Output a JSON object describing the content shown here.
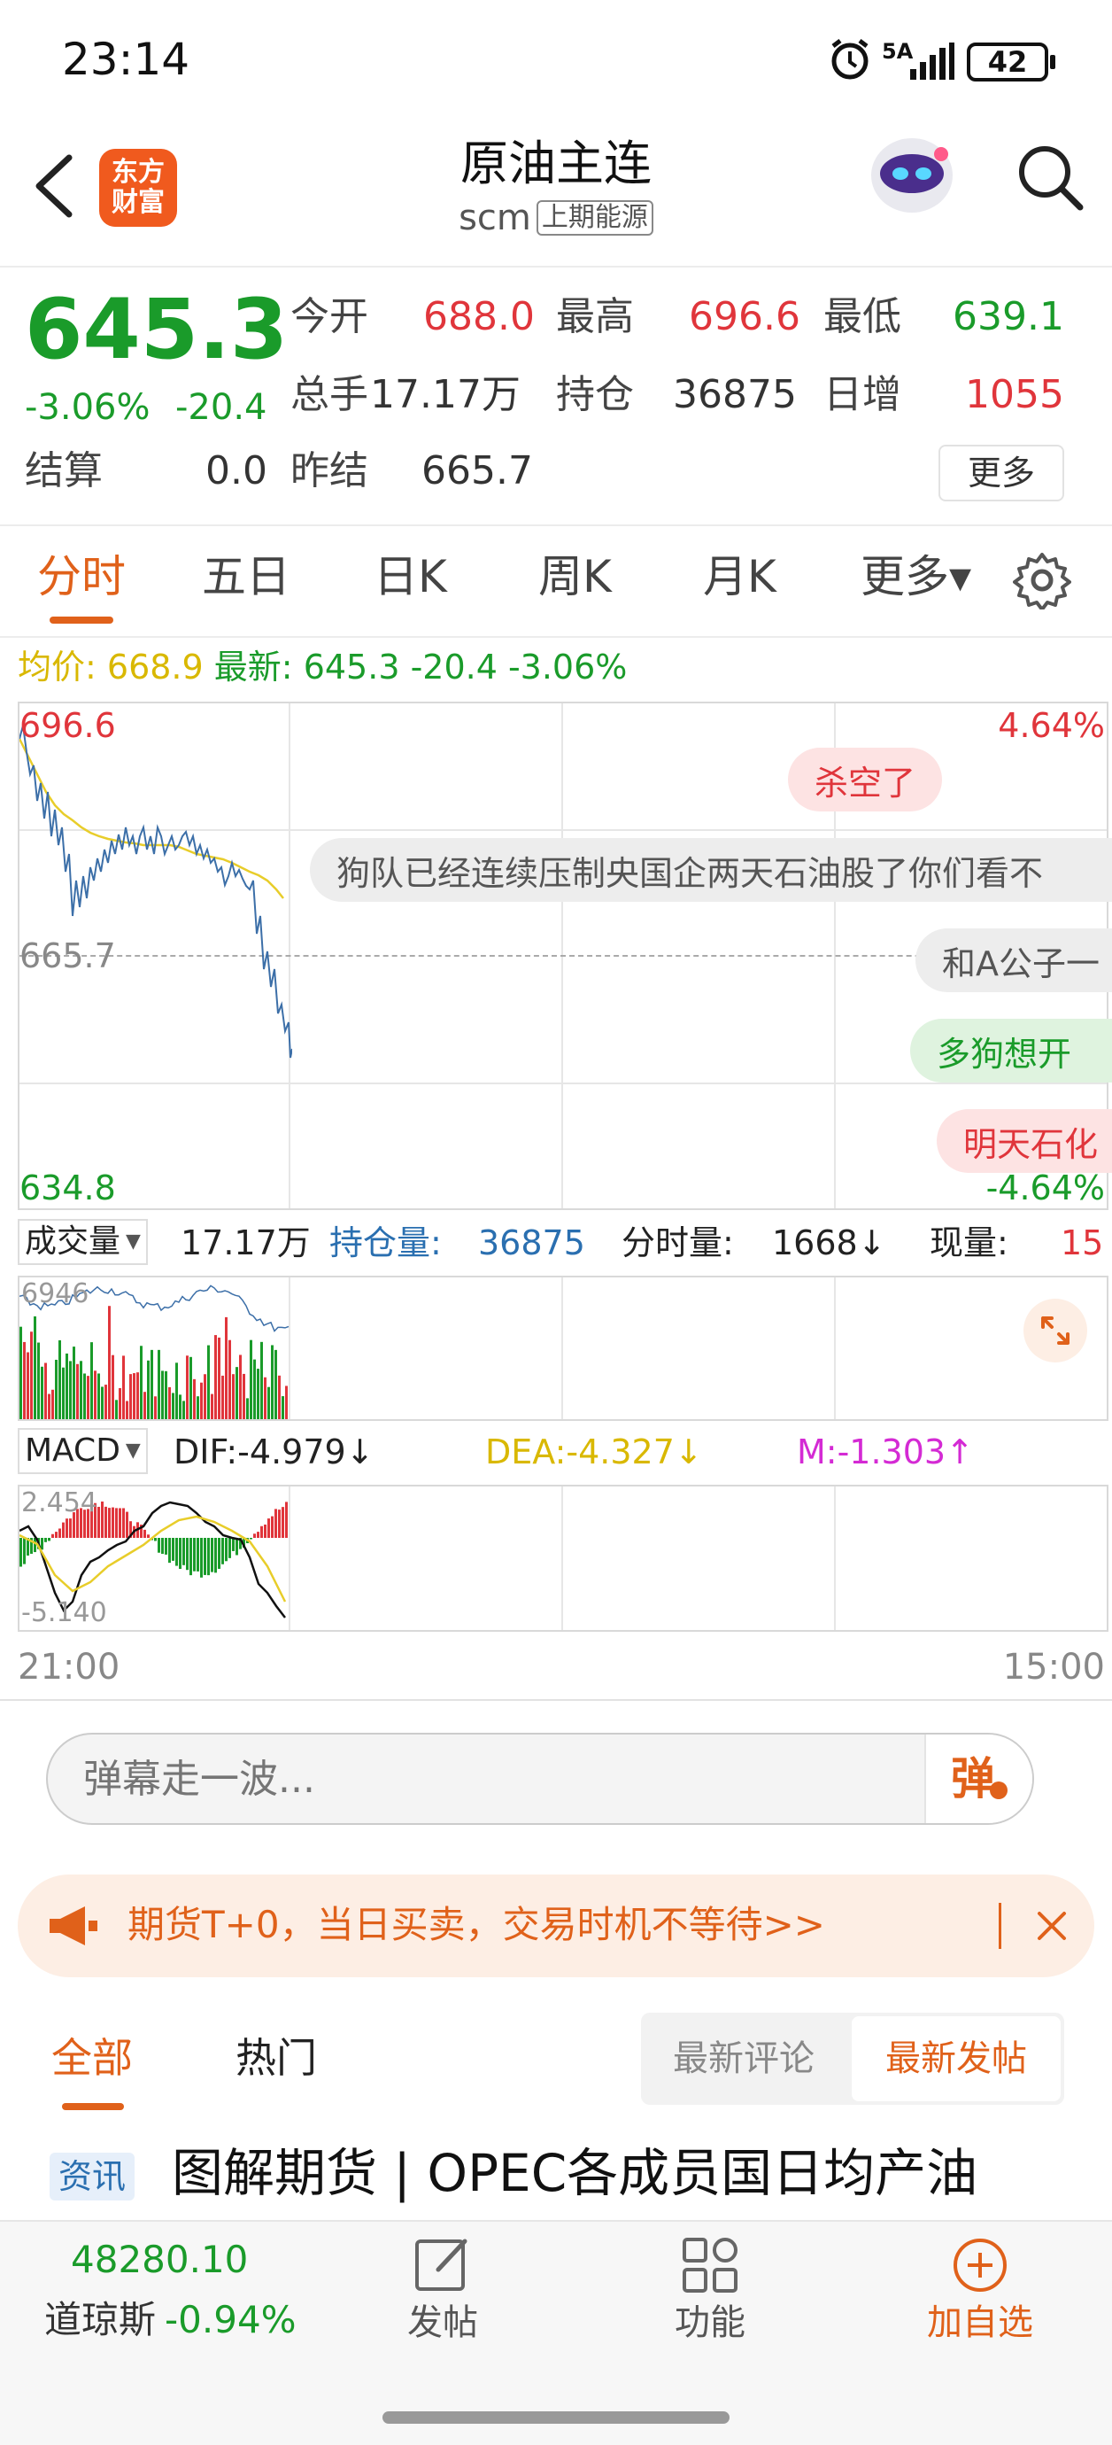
{
  "status": {
    "time": "23:14",
    "network": "5A",
    "battery": "42"
  },
  "header": {
    "title": "原油主连",
    "code": "scm",
    "exchange": "上期能源",
    "logo_line1": "东方",
    "logo_line2": "财富"
  },
  "quote": {
    "price": "645.3",
    "change_pct": "-3.06%",
    "change": "-20.4",
    "open_label": "今开",
    "open": "688.0",
    "high_label": "最高",
    "high": "696.6",
    "low_label": "最低",
    "low": "639.1",
    "volume_label": "总手",
    "volume": "17.17万",
    "position_label": "持仓",
    "position": "36875",
    "daily_inc_label": "日增",
    "daily_inc": "1055",
    "settle_label": "结算",
    "settle": "0.0",
    "prev_settle_label": "昨结",
    "prev_settle": "665.7",
    "more_button": "更多"
  },
  "tabs": [
    {
      "label": "分时",
      "active": true
    },
    {
      "label": "五日"
    },
    {
      "label": "日K"
    },
    {
      "label": "周K"
    },
    {
      "label": "月K"
    },
    {
      "label": "更多▾"
    }
  ],
  "chart_info": {
    "avg_label": "均价:",
    "avg": "668.9",
    "latest_label": "最新:",
    "latest": "645.3 -20.4 -3.06%"
  },
  "chart_axis": {
    "top_price": "696.6",
    "top_pct": "4.64%",
    "mid_price": "665.7",
    "bottom_price": "634.8",
    "bottom_pct": "-4.64%",
    "time_start": "21:00",
    "time_end": "15:00"
  },
  "danmaku": [
    {
      "text": "杀空了"
    },
    {
      "text": "狗队已经连续压制央国企两天石油股了你们看不"
    },
    {
      "text": "和A公子一"
    },
    {
      "text": "多狗想开"
    },
    {
      "text": "明天石化"
    }
  ],
  "volume_bar": {
    "selector": "成交量",
    "volume": "17.17万",
    "pos_label": "持仓量:",
    "pos_value": "36875",
    "tick_label": "分时量:",
    "tick_value": "1668↓",
    "now_label": "现量:",
    "now_value": "15"
  },
  "volume_axis": {
    "top": "6946"
  },
  "macd": {
    "selector": "MACD",
    "dif": "DIF:-4.979↓",
    "dea": "DEA:-4.327↓",
    "m": "M:-1.303↑",
    "top": "2.454",
    "bottom": "-5.140"
  },
  "comment_input": {
    "placeholder": "弹幕走一波...",
    "send_label": "弹"
  },
  "promo": {
    "text": "期货T+0，当日买卖，交易时机不等待>>"
  },
  "feed_tabs": {
    "all": "全部",
    "hot": "热门",
    "latest_comment": "最新评论",
    "latest_post": "最新发帖"
  },
  "news": {
    "tag": "资讯",
    "title": "图解期货 | OPEC各成员国日均产油"
  },
  "bottom_nav": {
    "index_value": "48280.10",
    "index_name": "道琼斯",
    "index_change": "-0.94%",
    "post": "发帖",
    "functions": "功能",
    "add_watch": "加自选"
  },
  "colors": {
    "up": "#e0353b",
    "down": "#1a9b2a",
    "accent": "#e0611a",
    "price_line": "#3c6fa8",
    "avg_line": "#e8cd2a"
  }
}
